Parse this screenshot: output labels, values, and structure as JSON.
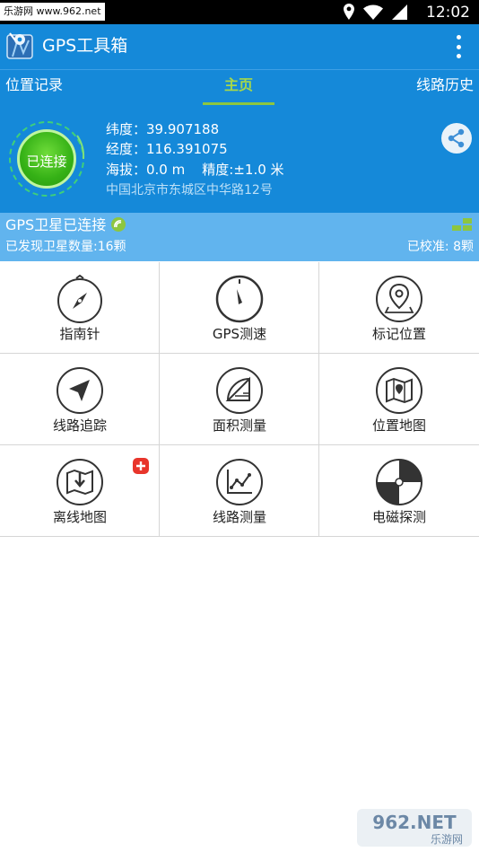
{
  "statusbar": {
    "watermark": "乐游网 www.962.net",
    "time": "12:02"
  },
  "app": {
    "title": "GPS工具箱"
  },
  "tabs": [
    {
      "label": "位置记录",
      "active": false
    },
    {
      "label": "主页",
      "active": true
    },
    {
      "label": "线路历史",
      "active": false
    }
  ],
  "position": {
    "status": "已连接",
    "latitude": "纬度：39.907188",
    "longitude": "经度：116.391075",
    "altitude_accuracy": "海拔：0.0 m    精度:±1.0 米",
    "address": "中国北京市东城区中华路12号"
  },
  "satellite": {
    "status": "GPS卫星已连接",
    "found": "已发现卫星数量:16颗",
    "calibrated": "已校准: 8颗"
  },
  "tools": [
    {
      "label": "指南针",
      "icon": "compass-icon"
    },
    {
      "label": "GPS测速",
      "icon": "speedometer-icon"
    },
    {
      "label": "标记位置",
      "icon": "map-pin-icon"
    },
    {
      "label": "线路追踪",
      "icon": "navigation-arrow-icon"
    },
    {
      "label": "面积测量",
      "icon": "protractor-icon"
    },
    {
      "label": "位置地图",
      "icon": "map-icon"
    },
    {
      "label": "离线地图",
      "icon": "download-map-icon"
    },
    {
      "label": "线路测量",
      "icon": "line-chart-icon"
    },
    {
      "label": "电磁探测",
      "icon": "magnetic-disc-icon"
    }
  ],
  "watermark_bottom": {
    "brand": "962.NET",
    "sub": "乐游网"
  },
  "colors": {
    "primary": "#1589d9",
    "accent": "#8dc63f",
    "satbar": "#61b4ee",
    "connected": "#35b116",
    "badge": "#e8352b"
  }
}
